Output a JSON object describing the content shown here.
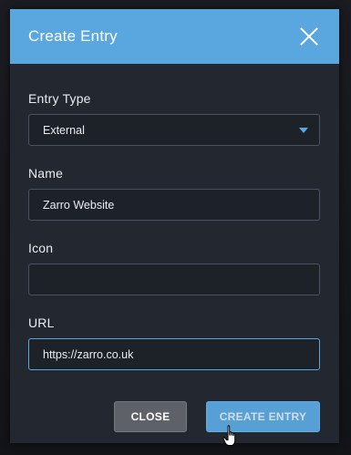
{
  "modal": {
    "title": "Create Entry"
  },
  "form": {
    "entry_type": {
      "label": "Entry Type",
      "value": "External"
    },
    "name": {
      "label": "Name",
      "value": "Zarro Website"
    },
    "icon": {
      "label": "Icon",
      "value": ""
    },
    "url": {
      "label": "URL",
      "value": "https://zarro.co.uk"
    }
  },
  "footer": {
    "close_label": "CLOSE",
    "create_label": "CREATE ENTRY"
  },
  "colors": {
    "accent": "#5aa7df",
    "modal_bg": "#232830",
    "input_bg": "#1d2128",
    "close_button_bg": "#5e6167"
  },
  "icons": {
    "dismiss": "close-icon",
    "dropdown": "chevron-down-icon",
    "cursor": "hand-pointer-icon"
  }
}
